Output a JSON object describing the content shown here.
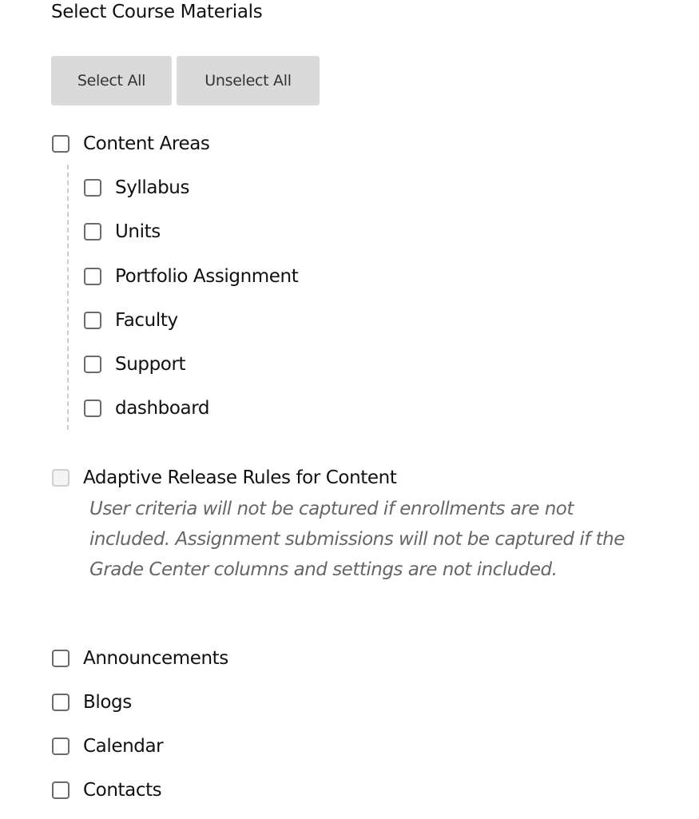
{
  "section": {
    "title": "Select Course Materials"
  },
  "buttons": {
    "select_all": "Select All",
    "unselect_all": "Unselect All"
  },
  "content_areas": {
    "label": "Content Areas",
    "checked": false,
    "children": [
      {
        "label": "Syllabus",
        "checked": false
      },
      {
        "label": "Units",
        "checked": false
      },
      {
        "label": "Portfolio Assignment",
        "checked": false
      },
      {
        "label": "Faculty",
        "checked": false
      },
      {
        "label": "Support",
        "checked": false
      },
      {
        "label": "dashboard",
        "checked": false
      }
    ]
  },
  "adaptive_release": {
    "label": "Adaptive Release Rules for Content",
    "checked": false,
    "disabled": true,
    "note": "User criteria will not be captured if enrollments are not included. Assignment submissions will not be captured if the Grade Center columns and settings are not included."
  },
  "other_items": [
    {
      "label": "Announcements",
      "checked": false
    },
    {
      "label": "Blogs",
      "checked": false
    },
    {
      "label": "Calendar",
      "checked": false
    },
    {
      "label": "Contacts",
      "checked": false
    }
  ]
}
